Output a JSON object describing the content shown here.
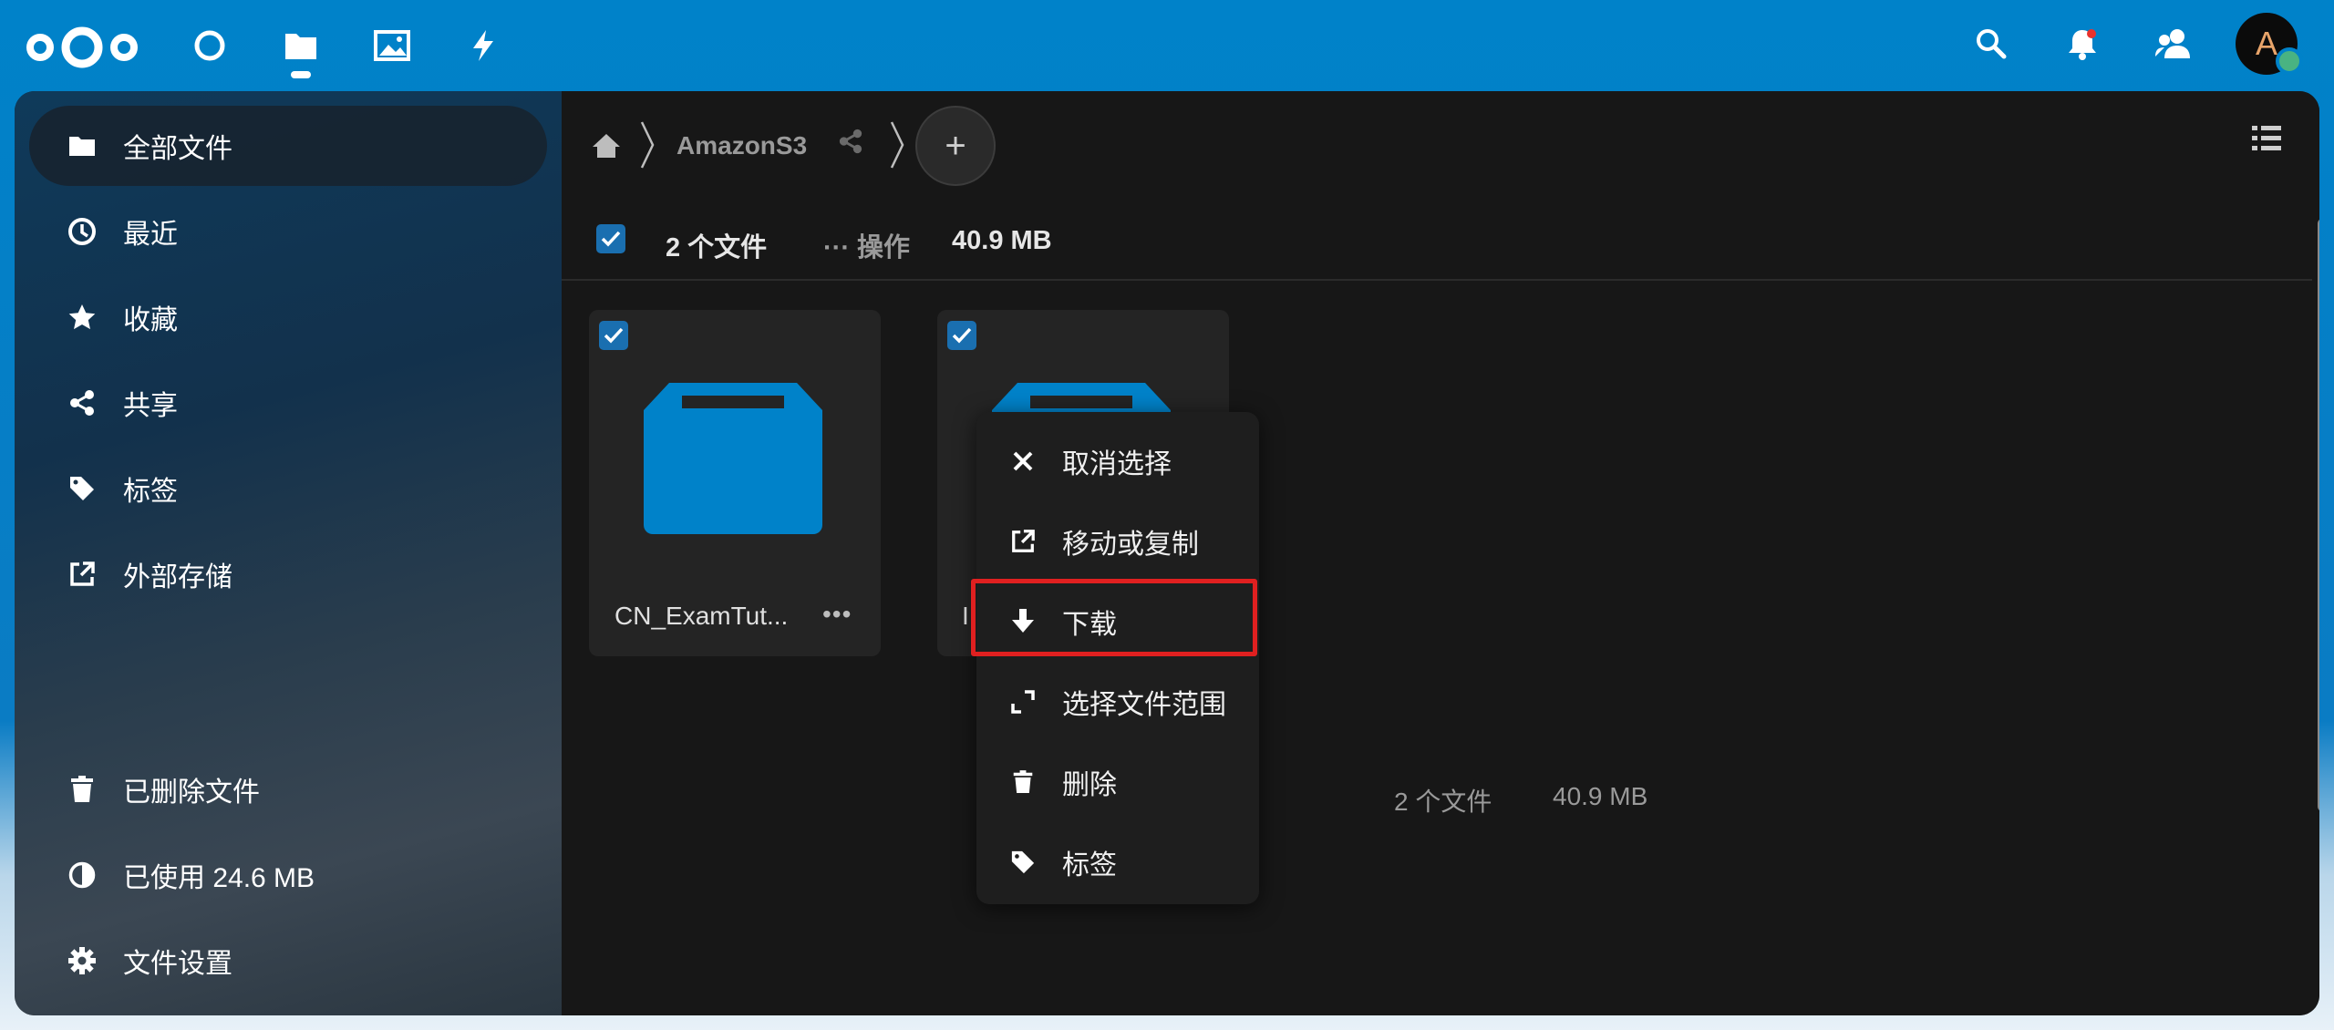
{
  "header": {
    "apps": [
      {
        "name": "dashboard-icon"
      },
      {
        "name": "files-icon",
        "active": true
      },
      {
        "name": "photos-icon"
      },
      {
        "name": "activity-icon"
      }
    ],
    "avatar_letter": "A",
    "brand_color": "#0082c9"
  },
  "sidebar": {
    "items": [
      {
        "label": "全部文件",
        "icon": "folder-icon",
        "active": true
      },
      {
        "label": "最近",
        "icon": "clock-icon"
      },
      {
        "label": "收藏",
        "icon": "star-icon"
      },
      {
        "label": "共享",
        "icon": "share-icon"
      },
      {
        "label": "标签",
        "icon": "tag-icon"
      },
      {
        "label": "外部存储",
        "icon": "external-link-icon"
      }
    ],
    "trash_label": "已删除文件",
    "quota_label": "已使用 24.6 MB",
    "settings_label": "文件设置"
  },
  "breadcrumb": {
    "folder": "AmazonS3",
    "new_label": "+"
  },
  "selection": {
    "count": "2 个文件",
    "actions": "操作",
    "size": "40.9 MB"
  },
  "files": [
    {
      "name": "CN_ExamTut...",
      "selected": true
    },
    {
      "name": "I",
      "selected": true
    }
  ],
  "summary": {
    "count": "2 个文件",
    "size": "40.9 MB"
  },
  "context_menu": {
    "items": [
      {
        "label": "取消选择",
        "icon": "close-icon"
      },
      {
        "label": "移动或复制",
        "icon": "move-copy-icon"
      },
      {
        "label": "下载",
        "icon": "download-icon",
        "highlighted": true
      },
      {
        "label": "选择文件范围",
        "icon": "select-range-icon"
      },
      {
        "label": "删除",
        "icon": "trash-icon"
      },
      {
        "label": "标签",
        "icon": "tag-icon"
      }
    ]
  },
  "colors": {
    "folder": "#0082c9",
    "checkbox": "#1a6fb0",
    "highlight_border": "#e02020"
  }
}
